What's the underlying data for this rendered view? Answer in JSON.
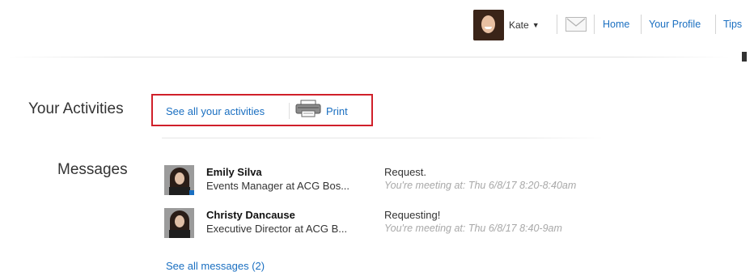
{
  "header": {
    "user_name": "Kate",
    "nav": [
      {
        "label": "Home"
      },
      {
        "label": "Your Profile"
      },
      {
        "label": "Tips"
      }
    ]
  },
  "activities": {
    "title": "Your Activities",
    "see_all_label": "See all your activities",
    "print_label": "Print"
  },
  "messages": {
    "title": "Messages",
    "items": [
      {
        "name": "Emily Silva",
        "role": "Events Manager at ACG Bos...",
        "subject": "Request.",
        "snippet": "You're meeting at: Thu 6/8/17 8:20-8:40am"
      },
      {
        "name": "Christy Dancause",
        "role": "Executive Director at ACG B...",
        "subject": "Requesting!",
        "snippet": "You're meeting at: Thu 6/8/17 8:40-9am"
      }
    ],
    "see_all_label": "See all messages (2)"
  },
  "colors": {
    "link": "#1a6fc1",
    "highlight_border": "#d0202a"
  }
}
